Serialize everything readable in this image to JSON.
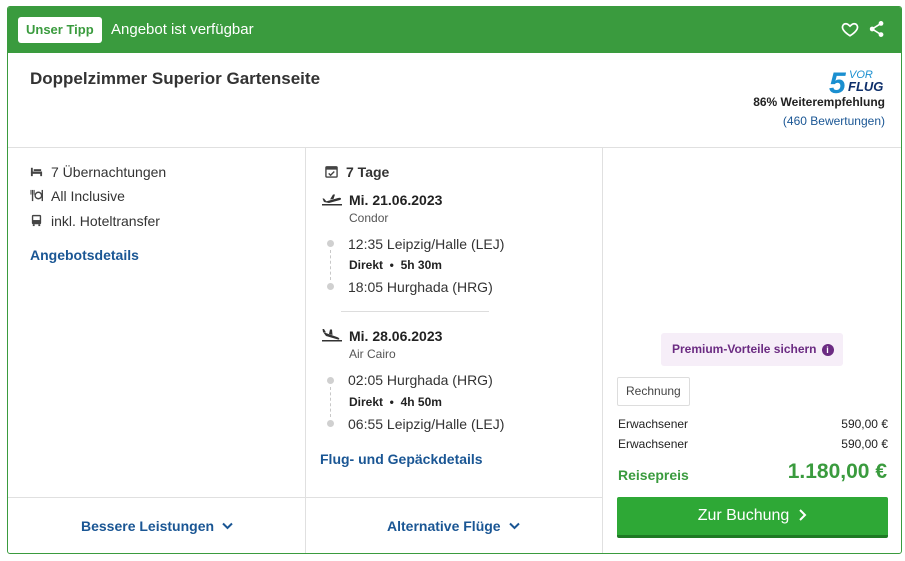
{
  "header": {
    "badge": "Unser Tipp",
    "availability": "Angebot ist verfügbar"
  },
  "hotel": {
    "room_title": "Doppelzimmer Superior Gartenseite",
    "rating_logo_text": [
      "5",
      "VOR",
      "FLUG"
    ],
    "recommendation": "86% Weiterempfehlung",
    "reviews": "(460 Bewertungen)"
  },
  "features": {
    "nights": "7 Übernachtungen",
    "board": "All Inclusive",
    "transfer": "inkl. Hoteltransfer",
    "details_link": "Angebotsdetails"
  },
  "flights": {
    "duration": "7 Tage",
    "outbound": {
      "date": "Mi. 21.06.2023",
      "airline": "Condor",
      "dep": "12:35 Leipzig/Halle (LEJ)",
      "direct": "Direkt",
      "flight_time": "5h 30m",
      "arr": "18:05 Hurghada (HRG)"
    },
    "return": {
      "date": "Mi. 28.06.2023",
      "airline": "Air Cairo",
      "dep": "02:05 Hurghada (HRG)",
      "direct": "Direkt",
      "flight_time": "4h 50m",
      "arr": "06:55 Leipzig/Halle (LEJ)"
    },
    "details_link": "Flug- und Gepäckdetails"
  },
  "pricing": {
    "premium": "Premium-Vorteile sichern",
    "invoice": "Rechnung",
    "rows": [
      {
        "label": "Erwachsener",
        "value": "590,00 €"
      },
      {
        "label": "Erwachsener",
        "value": "590,00 €"
      }
    ],
    "total_label": "Reisepreis",
    "total": "1.180,00 €",
    "book_label": "Zur Buchung"
  },
  "footer": {
    "better_services": "Bessere Leistungen",
    "alt_flights": "Alternative Flüge"
  },
  "colors": {
    "brand_green": "#3a9b3e",
    "link_blue": "#1a5694",
    "premium_purple": "#6b2b82"
  },
  "icons": {
    "like": "heart-icon",
    "share": "share-icon",
    "nights": "bed-icon",
    "board": "cutlery-icon",
    "transfer": "bus-icon",
    "duration": "calendar-icon",
    "outbound": "plane-departure-icon",
    "return": "plane-arrival-icon",
    "premium_info": "info-icon"
  }
}
